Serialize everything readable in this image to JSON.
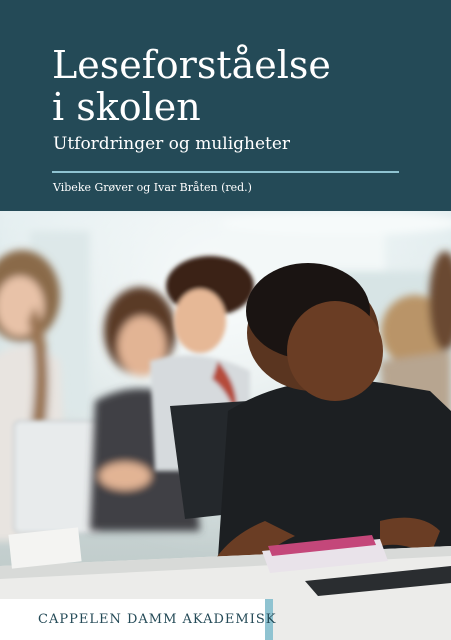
{
  "cover": {
    "title_line1": "Leseforståelse",
    "title_line2": "i skolen",
    "subtitle": "Utfordringer og muligheter",
    "authors": "Vibeke Grøver og Ivar Bråten (red.)",
    "publisher": "Cappelen Damm Akademisk"
  },
  "colors": {
    "band": "#244a57",
    "accent": "#8fc3d1",
    "text_on_band": "#ffffff"
  }
}
